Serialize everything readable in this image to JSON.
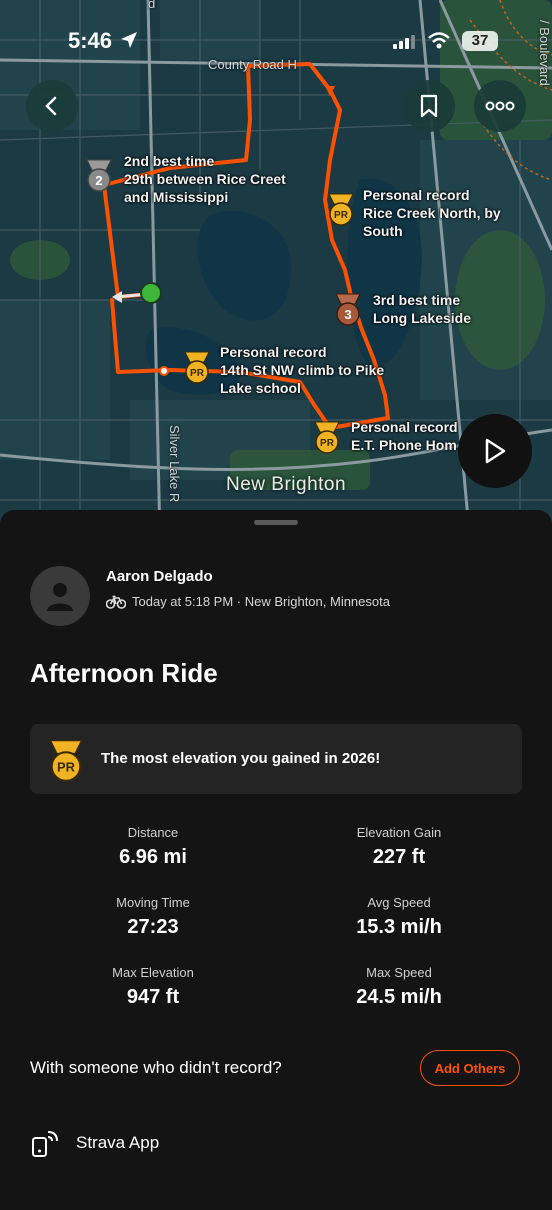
{
  "status_bar": {
    "time": "5:46",
    "battery": "37"
  },
  "map": {
    "road_labels": {
      "county_road": "County Road H",
      "silver_lake": "Silver Lake R",
      "boulevard": "/ Boulevard",
      "corner": "d"
    },
    "city": "New Brighton",
    "segments": [
      {
        "badge": "2",
        "status": "2nd best time",
        "name_line1": "29th between Rice Creet",
        "name_line2": "and Mississippi"
      },
      {
        "badge": "PR",
        "status": "Personal record",
        "name_line1": "Rice Creek North, by",
        "name_line2": "South"
      },
      {
        "badge": "3",
        "status": "3rd best time",
        "name_line1": "Long Lakeside",
        "name_line2": ""
      },
      {
        "badge": "PR",
        "status": "Personal record",
        "name_line1": "14th St NW climb to Pike",
        "name_line2": "Lake school"
      },
      {
        "badge": "PR",
        "status": "Personal record",
        "name_line1": "E.T. Phone Hom",
        "name_line2": ""
      }
    ]
  },
  "activity": {
    "athlete": "Aaron Delgado",
    "meta": "Today at 5:18 PM · New Brighton, Minnesota",
    "title": "Afternoon Ride",
    "achievement": {
      "badge": "PR",
      "text": "The most elevation you gained in 2026!"
    },
    "stats": [
      {
        "label": "Distance",
        "value": "6.96 mi"
      },
      {
        "label": "Elevation Gain",
        "value": "227 ft"
      },
      {
        "label": "Moving Time",
        "value": "27:23"
      },
      {
        "label": "Avg Speed",
        "value": "15.3 mi/h"
      },
      {
        "label": "Max Elevation",
        "value": "947 ft"
      },
      {
        "label": "Max Speed",
        "value": "24.5 mi/h"
      }
    ],
    "with_prompt": "With someone who didn't record?",
    "add_others": "Add Others",
    "device": "Strava App"
  },
  "colors": {
    "route": "#fc5200",
    "pr_gold": "#f0b323",
    "accent": "#fc5200"
  }
}
